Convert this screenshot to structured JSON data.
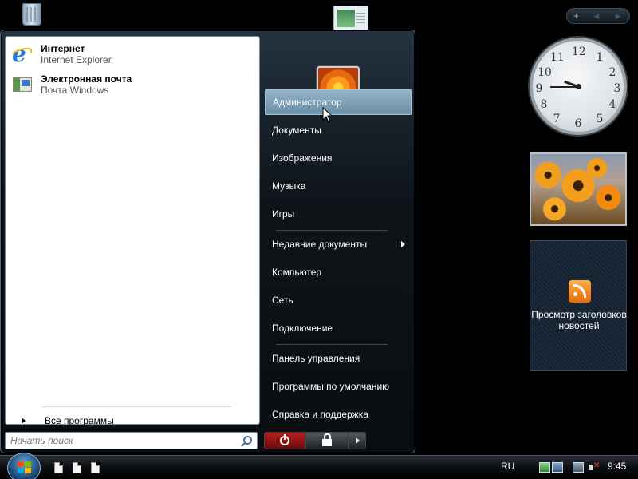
{
  "start_menu": {
    "pinned": [
      {
        "title": "Интернет",
        "subtitle": "Internet Explorer",
        "icon": "ie-icon"
      },
      {
        "title": "Электронная почта",
        "subtitle": "Почта Windows",
        "icon": "mail-icon"
      }
    ],
    "all_programs": "Все программы",
    "search_placeholder": "Начать поиск",
    "right_items": [
      {
        "label": "Администратор",
        "highlighted": true
      },
      {
        "label": "Документы"
      },
      {
        "label": "Изображения"
      },
      {
        "label": "Музыка"
      },
      {
        "label": "Игры"
      },
      {
        "label": "Недавние документы",
        "has_submenu": true
      },
      {
        "label": "Компьютер"
      },
      {
        "label": "Сеть"
      },
      {
        "label": "Подключение"
      },
      {
        "label": "Панель управления"
      },
      {
        "label": "Программы по умолчанию"
      },
      {
        "label": "Справка и поддержка"
      }
    ]
  },
  "sidebar": {
    "controls": [
      "+",
      "◄",
      "►"
    ],
    "clock_numbers": [
      "12",
      "1",
      "2",
      "3",
      "4",
      "5",
      "6",
      "7",
      "8",
      "9",
      "10",
      "11"
    ],
    "clock_time": "9:45",
    "rss_label": "Просмотр заголовков новостей"
  },
  "taskbar": {
    "language": "RU",
    "time": "9:45"
  },
  "colors": {
    "accent": "#6b8fa6",
    "power_red": "#b42020",
    "orb_blue": "#1b4c7a"
  }
}
